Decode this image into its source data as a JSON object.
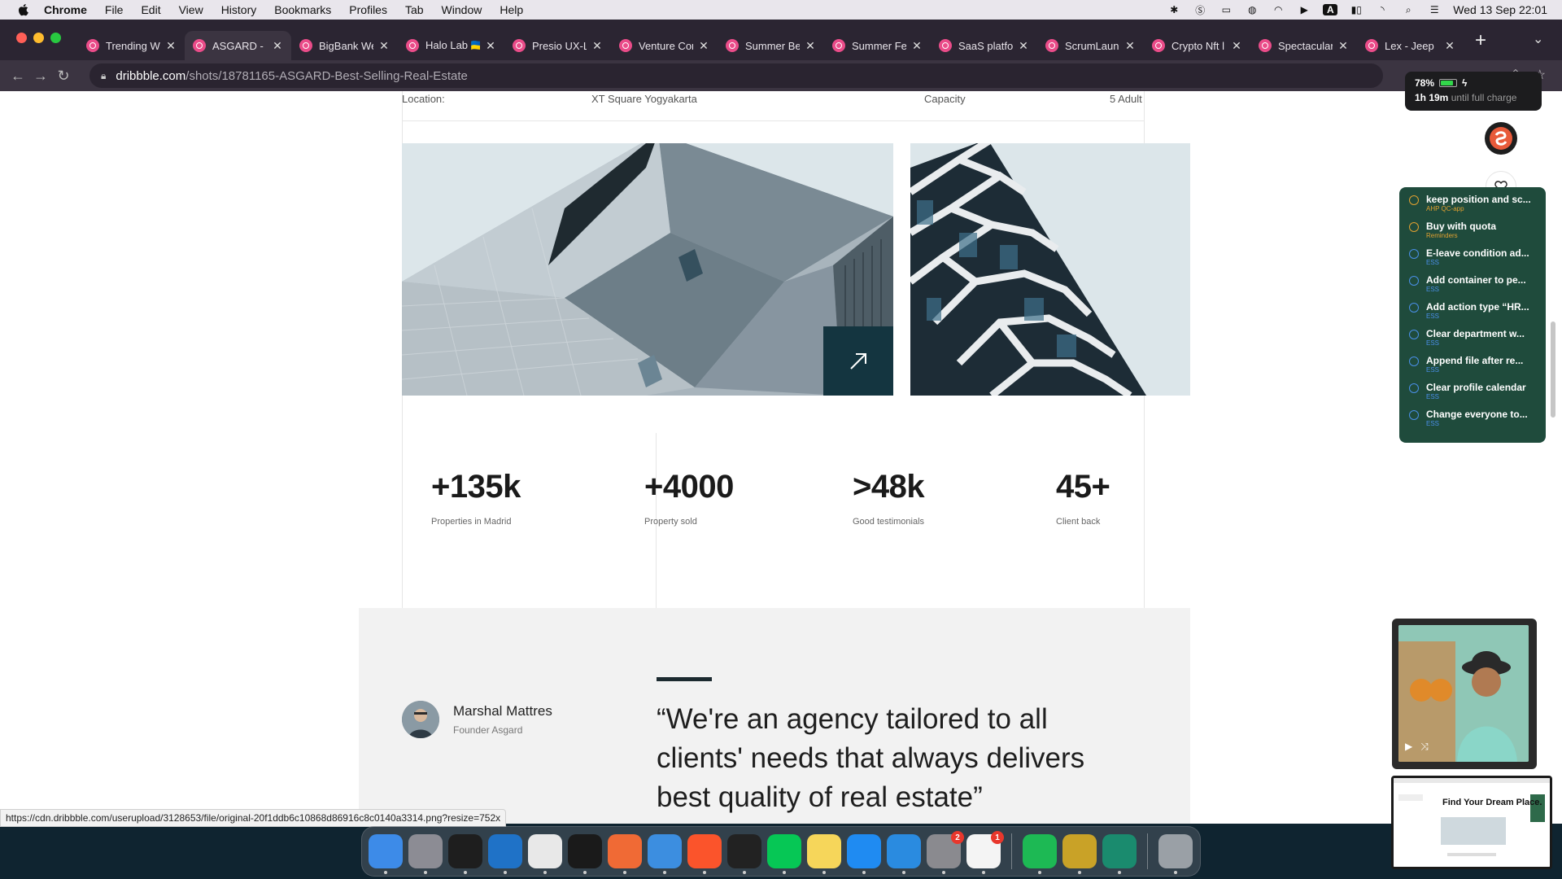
{
  "menubar": {
    "app_name": "Chrome",
    "items": [
      "File",
      "Edit",
      "View",
      "History",
      "Bookmarks",
      "Profiles",
      "Tab",
      "Window",
      "Help"
    ],
    "clock": "Wed 13 Sep  22:01"
  },
  "tabs": [
    {
      "label": "Trending We",
      "active": false
    },
    {
      "label": "ASGARD - B",
      "active": true
    },
    {
      "label": "BigBank We",
      "active": false
    },
    {
      "label": "Halo Lab 🇺🇦",
      "active": false
    },
    {
      "label": "Presio UX-L",
      "active": false
    },
    {
      "label": "Venture Cor",
      "active": false
    },
    {
      "label": "Summer Be",
      "active": false
    },
    {
      "label": "Summer Fe",
      "active": false
    },
    {
      "label": "SaaS platfo",
      "active": false
    },
    {
      "label": "ScrumLaun",
      "active": false
    },
    {
      "label": "Crypto Nft l",
      "active": false
    },
    {
      "label": "Spectacular",
      "active": false
    },
    {
      "label": "Lex - Jeep",
      "active": false
    }
  ],
  "omnibox": {
    "domain": "dribbble.com",
    "path": "/shots/18781165-ASGARD-Best-Selling-Real-Estate"
  },
  "battery": {
    "percent": "78%",
    "time": "1h 19m",
    "status": "until full charge"
  },
  "page": {
    "location_label": "Location:",
    "location_value": "XT Square Yogyakarta",
    "capacity_label": "Capacity",
    "capacity_value": "5 Adult",
    "stats": [
      {
        "value": "+135k",
        "label": "Properties in Madrid"
      },
      {
        "value": "+4000",
        "label": "Property sold"
      },
      {
        "value": ">48k",
        "label": "Good testimonials"
      },
      {
        "value": "45+",
        "label": "Client back"
      }
    ],
    "testimonial": {
      "name": "Marshal Mattres",
      "role": "Founder Asgard",
      "quote": "“We're an agency tailored to all clients' needs that always delivers best quality of real estate”"
    }
  },
  "reminders": [
    {
      "title": "keep position and sc...",
      "list": "AHP QC-app",
      "color": "#e0a030"
    },
    {
      "title": "Buy with quota",
      "list": "Reminders",
      "color": "#e0a030"
    },
    {
      "title": "E-leave condition ad...",
      "list": "ESS",
      "color": "#4a8fe8"
    },
    {
      "title": "Add container to pe...",
      "list": "ESS",
      "color": "#4a8fe8"
    },
    {
      "title": "Add action type “HR...",
      "list": "ESS",
      "color": "#4a8fe8"
    },
    {
      "title": "Clear department w...",
      "list": "ESS",
      "color": "#4a8fe8"
    },
    {
      "title": "Append file after re...",
      "list": "ESS",
      "color": "#4a8fe8"
    },
    {
      "title": "Clear profile calendar",
      "list": "ESS",
      "color": "#4a8fe8"
    },
    {
      "title": "Change everyone to...",
      "list": "ESS",
      "color": "#4a8fe8"
    }
  ],
  "thumbnail": {
    "title": "Find Your Dream Place."
  },
  "status_url": "https://cdn.dribbble.com/userupload/3128653/file/original-20f1ddb6c10868d86916c8c0140a3314.png?resize=752x",
  "dock": {
    "apps": [
      {
        "name": "finder-icon",
        "color": "#3d8be8",
        "badge": ""
      },
      {
        "name": "launchpad-icon",
        "color": "#8c8c94",
        "badge": ""
      },
      {
        "name": "figma-icon",
        "color": "#1e1e1e",
        "badge": ""
      },
      {
        "name": "vscode-icon",
        "color": "#1f72c7",
        "badge": ""
      },
      {
        "name": "chrome-icon",
        "color": "#e8e8e8",
        "badge": ""
      },
      {
        "name": "terminal-icon",
        "color": "#1a1a1a",
        "badge": ""
      },
      {
        "name": "paw-icon",
        "color": "#f06a35",
        "badge": ""
      },
      {
        "name": "safari-icon",
        "color": "#3c8ee0",
        "badge": ""
      },
      {
        "name": "brave-icon",
        "color": "#fb542b",
        "badge": ""
      },
      {
        "name": "activity-monitor-icon",
        "color": "#222222",
        "badge": ""
      },
      {
        "name": "line-icon",
        "color": "#06c755",
        "badge": ""
      },
      {
        "name": "notes-icon",
        "color": "#f6d65a",
        "badge": ""
      },
      {
        "name": "app-store-icon",
        "color": "#1f8bf2",
        "badge": ""
      },
      {
        "name": "xcode-icon",
        "color": "#2a8be0",
        "badge": ""
      },
      {
        "name": "system-settings-icon",
        "color": "#8a8a8f",
        "badge": "2"
      },
      {
        "name": "reminders-icon",
        "color": "#f4f4f4",
        "badge": "1"
      },
      {
        "name": "spotify-icon",
        "color": "#1db954",
        "badge": ""
      },
      {
        "name": "super-icon",
        "color": "#c9a227",
        "badge": ""
      },
      {
        "name": "vscode-insiders-icon",
        "color": "#1a8b6e",
        "badge": ""
      },
      {
        "name": "trash-icon",
        "color": "#9aa0a6",
        "badge": ""
      }
    ]
  }
}
